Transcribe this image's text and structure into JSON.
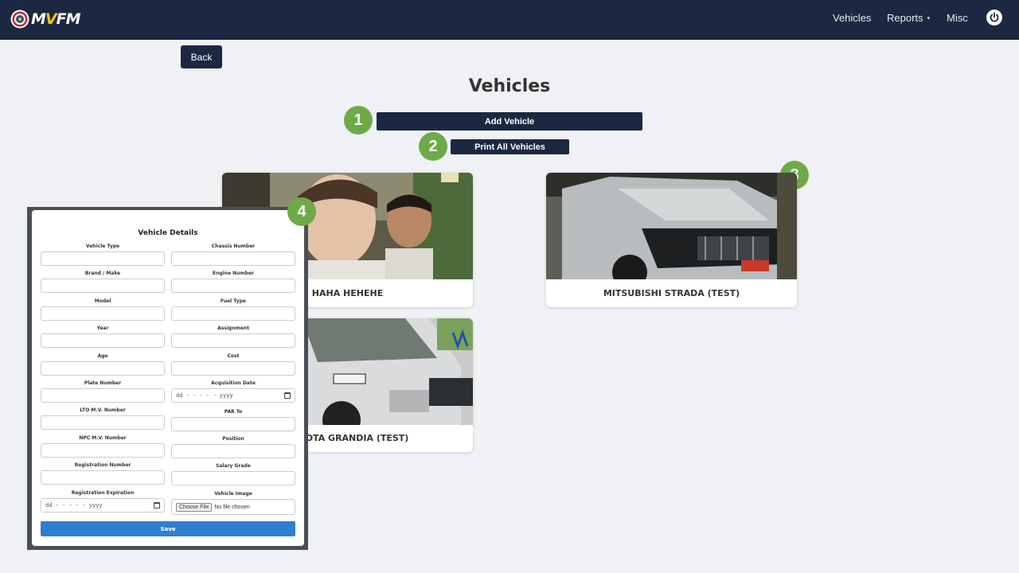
{
  "nav": {
    "logo_prefix": "M",
    "logo_v": "V",
    "logo_suffix": "FM",
    "items": [
      {
        "label": "Vehicles"
      },
      {
        "label": "Reports"
      },
      {
        "label": "Misc"
      }
    ],
    "reports_caret": "▾",
    "power_icon": "power-icon"
  },
  "back_label": "Back",
  "title": "Vehicles",
  "add_vehicle_label": "Add Vehicle",
  "print_all_label": "Print All Vehicles",
  "badges": [
    "1",
    "2",
    "3",
    "4"
  ],
  "vehicles": [
    {
      "name": "HAHA HEHEHE"
    },
    {
      "name": "TOYOTA GRANDIA (TEST)"
    },
    {
      "name": "MITSUBISHI STRADA (TEST)"
    }
  ],
  "form": {
    "title": "Vehicle Details",
    "fields_left": [
      "Vehicle Type",
      "Brand / Make",
      "Model",
      "Year",
      "Age",
      "Plate Number",
      "LTO M.V. Number",
      "NPC M.V. Number",
      "Registration Number",
      "Registration Expiration"
    ],
    "fields_right": [
      "Chassis Number",
      "Engine Number",
      "Fuel Type",
      "Assignment",
      "Cost",
      "Acquisition Date",
      "PAR To",
      "Position",
      "Salary Grade",
      "Vehicle Image"
    ],
    "date_placeholder": "dd - - - - - yyyy",
    "file_button": "Choose File",
    "file_status": "No file chosen",
    "save_label": "Save"
  },
  "colors": {
    "navbar": "#1c2841",
    "badge": "#6faa48",
    "save": "#2f7fd0",
    "logo_accent": "#f3c316"
  }
}
